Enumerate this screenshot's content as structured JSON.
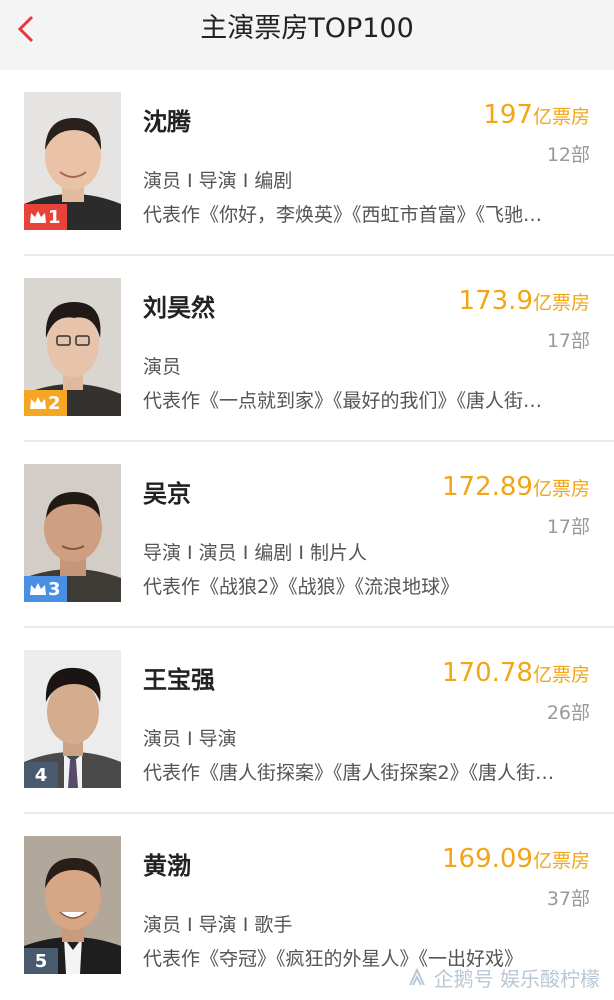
{
  "header": {
    "title": "主演票房TOP100",
    "back_icon": "chevron-left-icon",
    "accent_color": "#e4393c"
  },
  "colors": {
    "box_office": "#f2a516",
    "rank_1": "#e8433a",
    "rank_2": "#f5a623",
    "rank_3": "#4a90e2",
    "rank_other": "#4a5a6e"
  },
  "actors": [
    {
      "rank": "1",
      "name": "沈腾",
      "box_office": "197",
      "box_unit": "亿票房",
      "film_count": "12部",
      "roles": "演员 I 导演 I 编剧",
      "works": "代表作《你好，李焕英》《西虹市首富》《飞驰…"
    },
    {
      "rank": "2",
      "name": "刘昊然",
      "box_office": "173.9",
      "box_unit": "亿票房",
      "film_count": "17部",
      "roles": "演员",
      "works": "代表作《一点就到家》《最好的我们》《唐人街…"
    },
    {
      "rank": "3",
      "name": "吴京",
      "box_office": "172.89",
      "box_unit": "亿票房",
      "film_count": "17部",
      "roles": "导演 I 演员 I 编剧 I 制片人",
      "works": "代表作《战狼2》《战狼》《流浪地球》"
    },
    {
      "rank": "4",
      "name": "王宝强",
      "box_office": "170.78",
      "box_unit": "亿票房",
      "film_count": "26部",
      "roles": "演员 I 导演",
      "works": "代表作《唐人街探案》《唐人街探案2》《唐人街…"
    },
    {
      "rank": "5",
      "name": "黄渤",
      "box_office": "169.09",
      "box_unit": "亿票房",
      "film_count": "37部",
      "roles": "演员 I 导演 I 歌手",
      "works": "代表作《夺冠》《疯狂的外星人》《一出好戏》"
    }
  ],
  "watermark": {
    "text": "企鹅号 娱乐酸柠檬",
    "icon": "penguin-icon"
  }
}
